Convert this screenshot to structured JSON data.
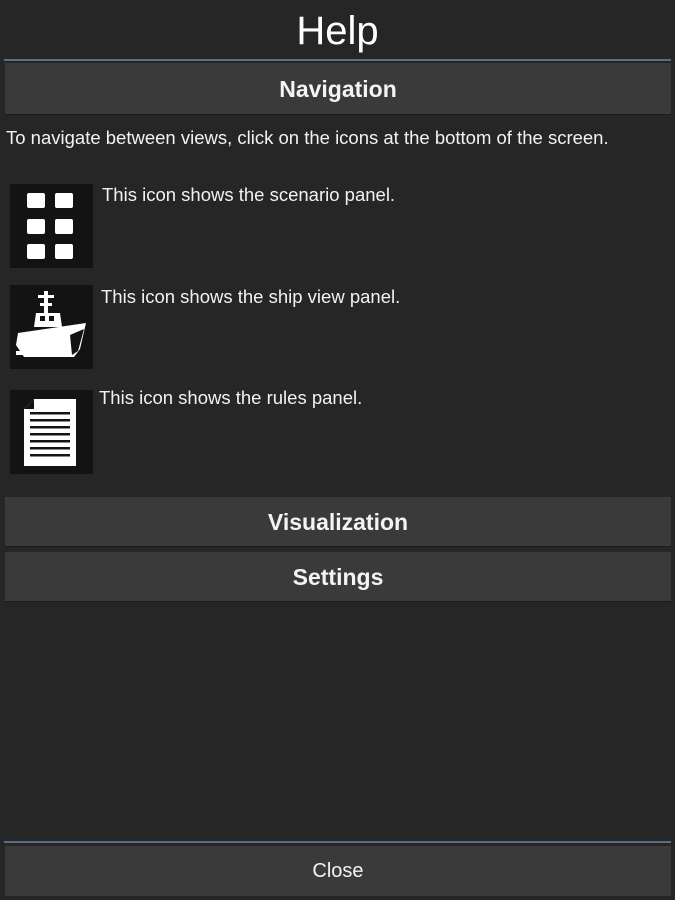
{
  "dialog": {
    "title": "Help",
    "close_label": "Close"
  },
  "sections": {
    "navigation": {
      "label": "Navigation",
      "intro": "To navigate between views, click on the icons at the bottom of the screen.",
      "items": [
        {
          "icon": "grid-icon",
          "text": "This icon shows the scenario panel."
        },
        {
          "icon": "ship-icon",
          "text": "This icon shows the ship view panel."
        },
        {
          "icon": "document-icon",
          "text": "This icon shows the rules panel."
        }
      ]
    },
    "visualization": {
      "label": "Visualization"
    },
    "settings": {
      "label": "Settings"
    }
  },
  "colors": {
    "background": "#262626",
    "header_bg": "#3a3a3a",
    "accent_rule": "#5a6f86",
    "icon_bg": "#131313"
  }
}
